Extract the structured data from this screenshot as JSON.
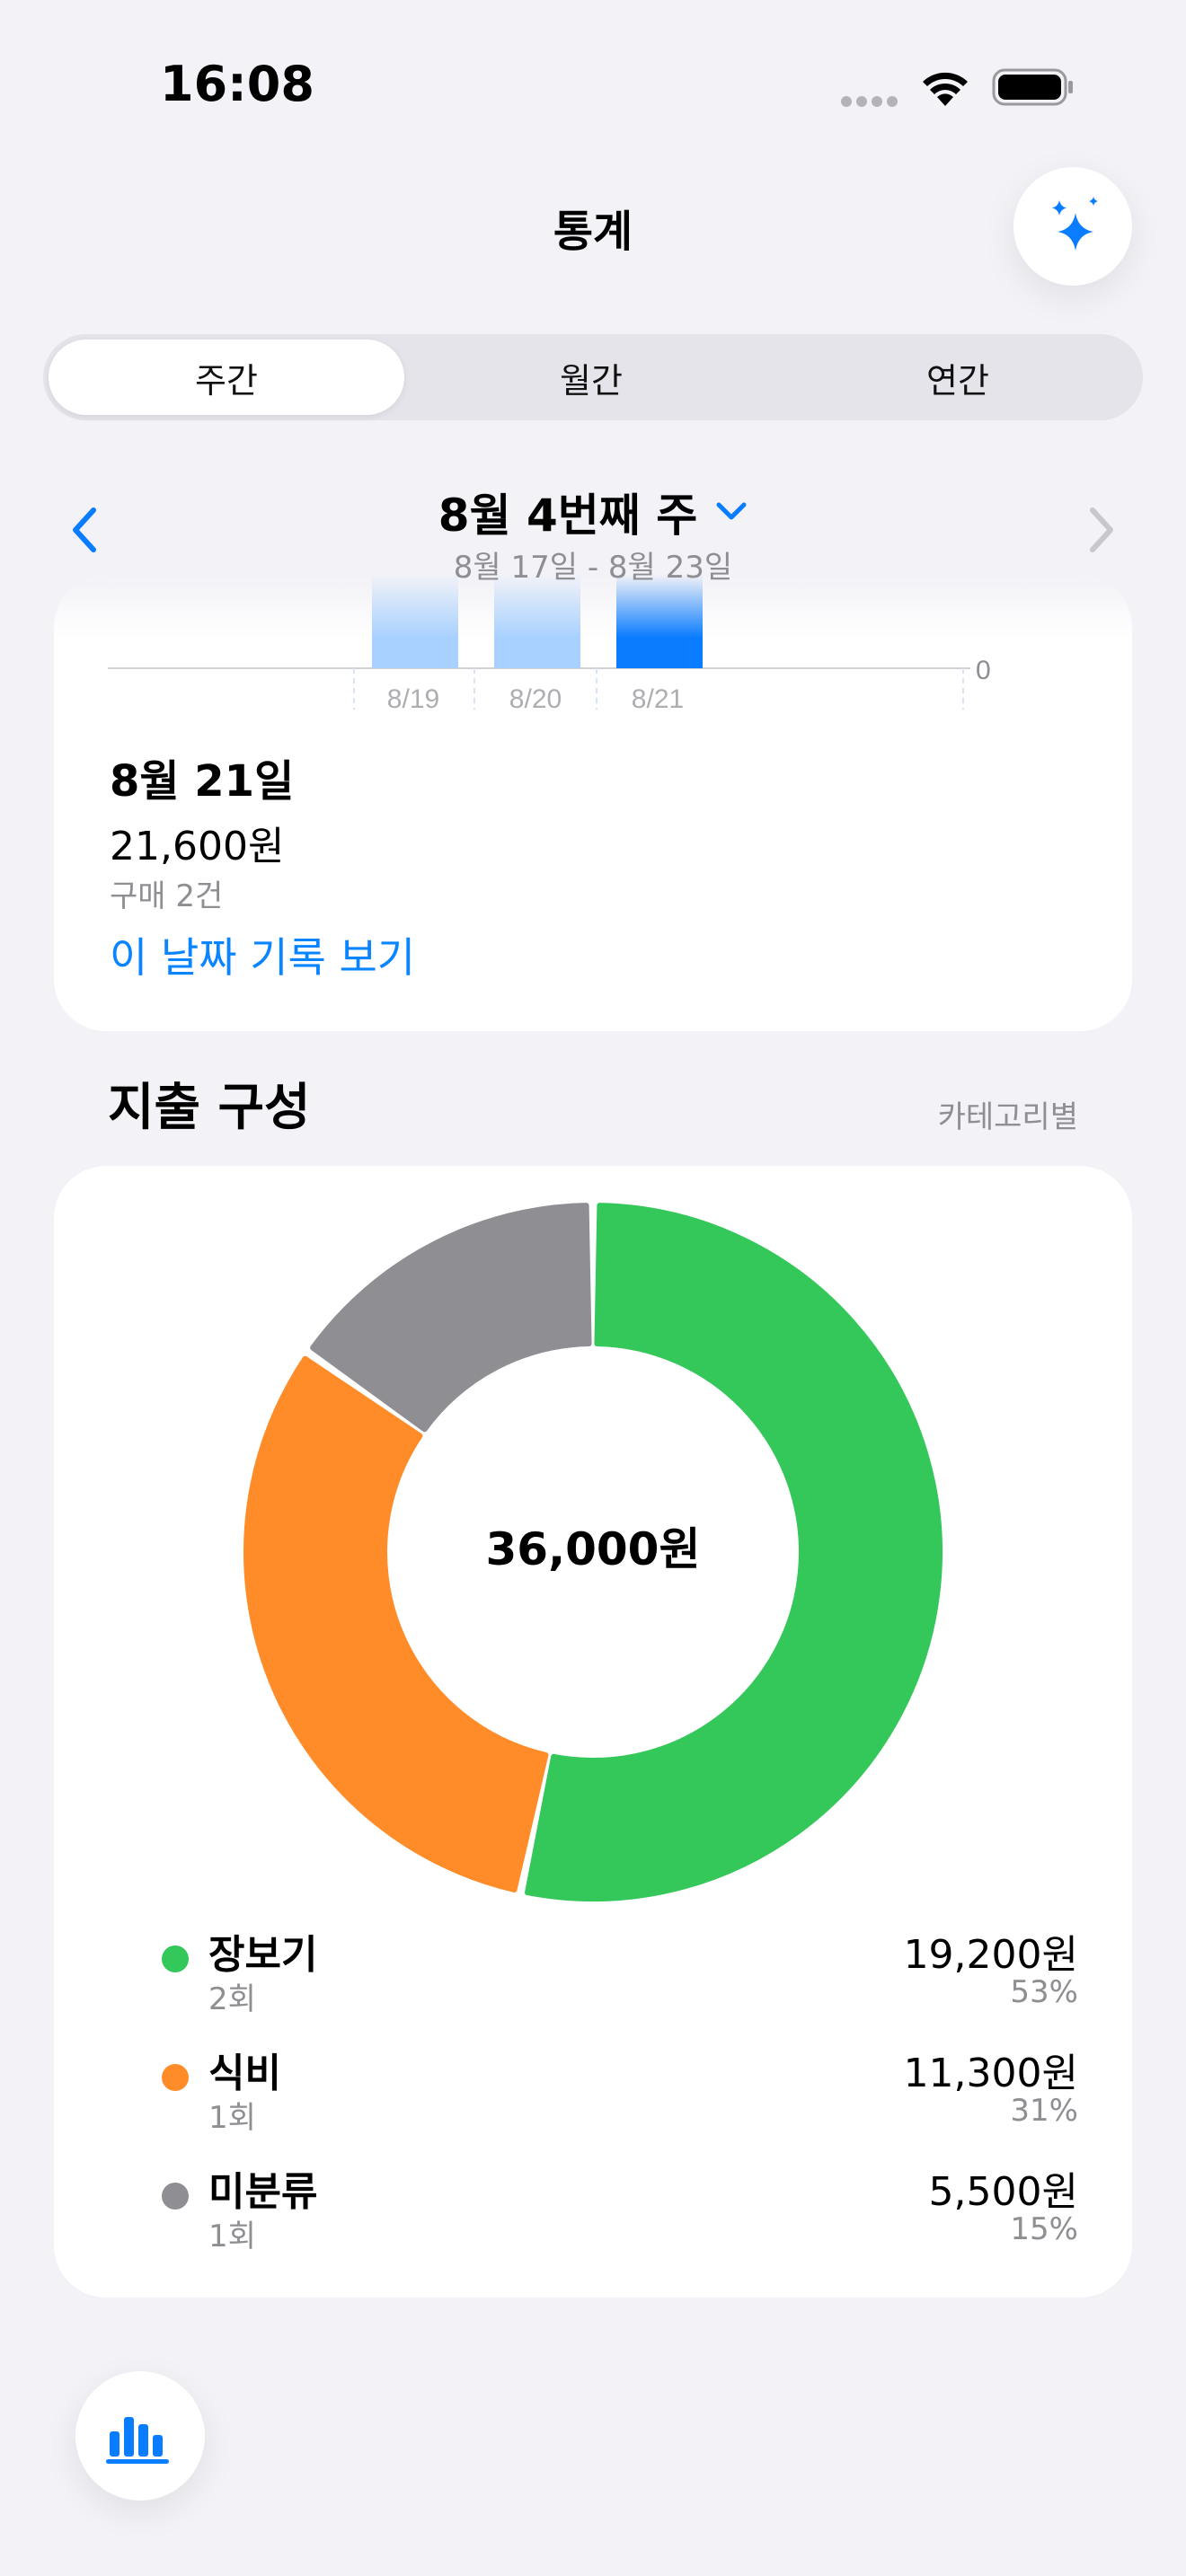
{
  "status_bar": {
    "time": "16:08"
  },
  "nav": {
    "title": "통계"
  },
  "segmented": {
    "tabs": [
      "주간",
      "월간",
      "연간"
    ],
    "selected": "주간"
  },
  "week": {
    "title": "8월 4번째 주",
    "range": "8월 17일 - 8월 23일"
  },
  "bar_chart": {
    "type": "bar",
    "categories": [
      "8/19",
      "8/20",
      "8/21"
    ],
    "y_axis_tick": "0",
    "selected": "8/21",
    "colors": {
      "normal": "#A8D1FF",
      "selected": "#0A7CFF"
    }
  },
  "day_detail": {
    "date": "8월 21일",
    "amount": "21,600원",
    "count": "구매 2건",
    "link": "이 날짜 기록 보기"
  },
  "composition": {
    "title": "지출 구성",
    "subtitle": "카테고리별",
    "total": "36,000원"
  },
  "chart_data": {
    "type": "pie",
    "categories": [
      "장보기",
      "식비",
      "미분류"
    ],
    "values": [
      19200,
      11300,
      5500
    ],
    "colors": [
      "#34C759",
      "#FF8C28",
      "#8E8E93"
    ],
    "center_label": "36,000원"
  },
  "legend": [
    {
      "name": "장보기",
      "count": "2회",
      "amount": "19,200원",
      "percent": "53%",
      "color": "#34C759"
    },
    {
      "name": "식비",
      "count": "1회",
      "amount": "11,300원",
      "percent": "31%",
      "color": "#FF8C28"
    },
    {
      "name": "미분류",
      "count": "1회",
      "amount": "5,500원",
      "percent": "15%",
      "color": "#8E8E93"
    }
  ],
  "icons": {
    "ai": "sparkles-icon",
    "prev": "chevron-left-icon",
    "next": "chevron-right-icon",
    "dropdown": "chevron-down-icon",
    "tab": "bar-chart-icon"
  },
  "accent": "#0A84FF"
}
